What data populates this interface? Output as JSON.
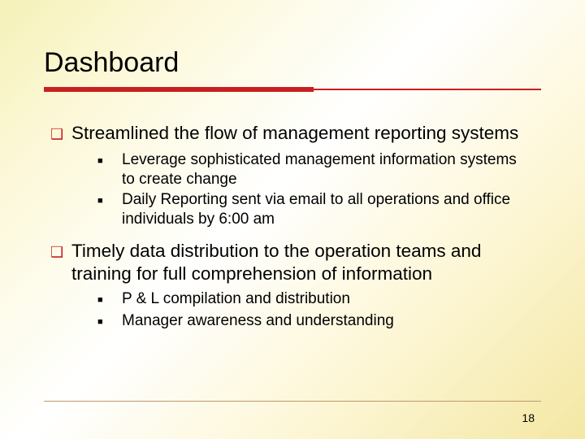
{
  "title": "Dashboard",
  "points": [
    {
      "text": "Streamlined the flow of management reporting systems",
      "sub": [
        "Leverage sophisticated management information systems to create change",
        "Daily Reporting sent via email to all operations and office individuals by 6:00 am"
      ]
    },
    {
      "text": "Timely data distribution to the operation teams and training for full comprehension of information",
      "sub": [
        "P & L compilation and distribution",
        "Manager awareness and understanding"
      ]
    }
  ],
  "page_number": "18"
}
